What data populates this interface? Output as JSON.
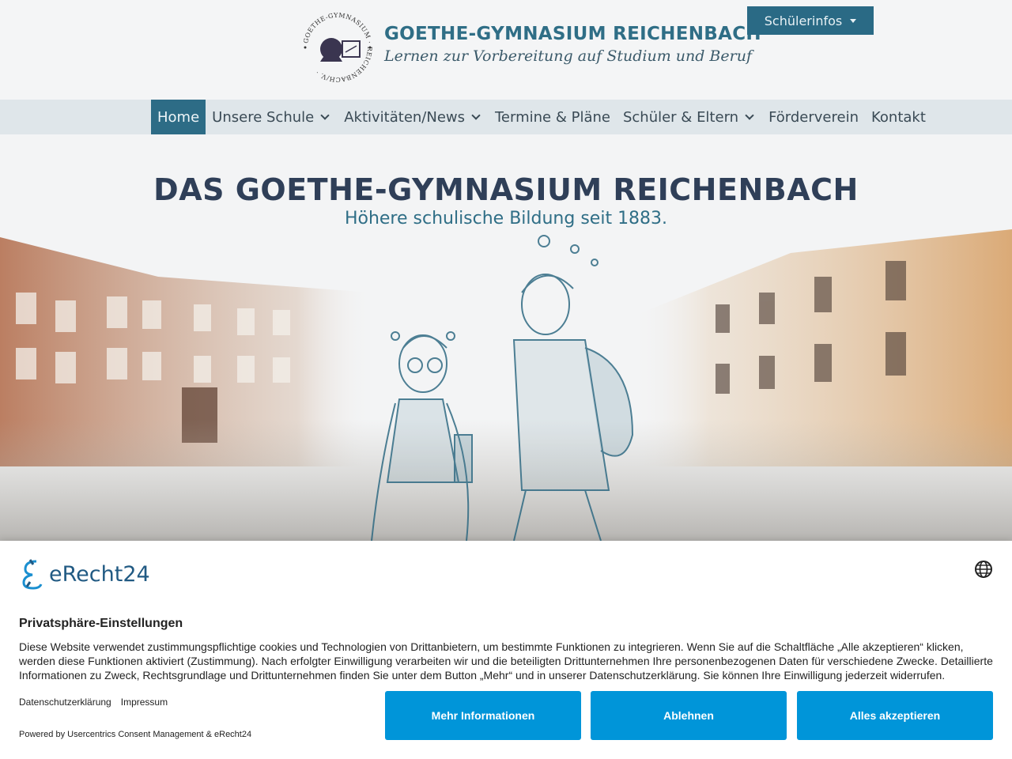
{
  "header": {
    "site_name": "GOETHE-GYMNASIUM REICHENBACH",
    "tagline": "Lernen zur Vorbereitung auf Studium und Beruf",
    "logo_ring_text": "GOETHE-GYMNASIUM · REICHENBACH/V. ·",
    "schuelerinfos_label": "Schülerinfos"
  },
  "nav": {
    "items": [
      {
        "label": "Home"
      },
      {
        "label": "Unsere Schule"
      },
      {
        "label": "Aktivitäten/News"
      },
      {
        "label": "Termine & Pläne"
      },
      {
        "label": "Schüler & Eltern"
      },
      {
        "label": "Förderverein"
      },
      {
        "label": "Kontakt"
      }
    ]
  },
  "hero": {
    "title": "DAS GOETHE-GYMNASIUM REICHENBACH",
    "subtitle": "Höhere schulische Bildung seit 1883."
  },
  "consent": {
    "brand": "eRecht24",
    "title": "Privatsphäre-Einstellungen",
    "text": "Diese Website verwendet zustimmungspflichtige cookies und Technologien von Drittanbietern, um bestimmte Funktionen zu integrieren. Wenn Sie auf die Schaltfläche „Alle akzeptieren“ klicken, werden diese Funktionen aktiviert (Zustimmung). Nach erfolgter Einwilligung verarbeiten wir und die beteiligten Drittunternehmen Ihre personenbezogenen Daten für verschiedene Zwecke. Detaillierte Informationen zu Zweck, Rechtsgrundlage und Drittunternehmen finden Sie unter dem Button „Mehr“ und in unserer Datenschutzerklärung. Sie können Ihre Einwilligung jederzeit widerrufen.",
    "link_privacy": "Datenschutzerklärung",
    "link_imprint": "Impressum",
    "powered": "Powered by Usercentrics Consent Management & eRecht24",
    "btn_more": "Mehr Informationen",
    "btn_reject": "Ablehnen",
    "btn_accept": "Alles akzeptieren"
  },
  "colors": {
    "primary": "#2a6a85",
    "consent_button": "#0095d9",
    "hero_title": "#2f3f58"
  }
}
